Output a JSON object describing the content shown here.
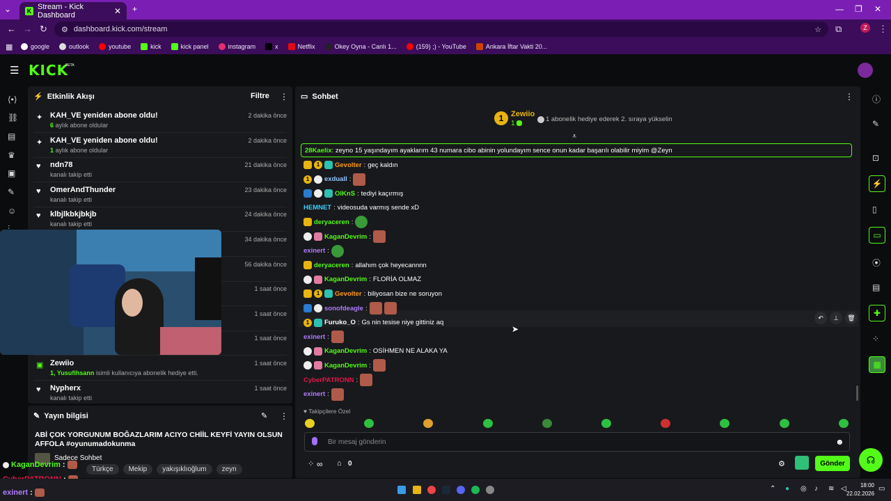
{
  "browser": {
    "tab_title": "Stream - Kick Dashboard",
    "url": "dashboard.kick.com/stream",
    "profile_initial": "Z",
    "bookmarks": [
      "google",
      "outlook",
      "youtube",
      "kick",
      "kick panel",
      "instagram",
      "x",
      "Netflix",
      "Okey Oyna - Canlı 1...",
      "(159) ;) - YouTube",
      "Ankara İftar Vakti 20..."
    ]
  },
  "app": {
    "logo": "KICK",
    "logo_beta": "BETA"
  },
  "activity": {
    "title": "Etkinlik Akışı",
    "filter_label": "Filtre",
    "items": [
      {
        "name": "KAH_VE yeniden abone oldu!",
        "highlight": "6",
        "sub": " aylık abone oldular",
        "time": "2 dakika önce",
        "icon": "sparkle"
      },
      {
        "name": "KAH_VE yeniden abone oldu!",
        "highlight": "1",
        "sub": " aylık abone oldular",
        "time": "2 dakika önce",
        "icon": "sparkle"
      },
      {
        "name": "ndn78",
        "highlight": "",
        "sub": "kanalı takip etti",
        "time": "21 dakika önce",
        "icon": "heart"
      },
      {
        "name": "OmerAndThunder",
        "highlight": "",
        "sub": "kanalı takip etti",
        "time": "23 dakika önce",
        "icon": "heart"
      },
      {
        "name": "klbjlkbkjbkjb",
        "highlight": "",
        "sub": "kanalı takip etti",
        "time": "24 dakika önce",
        "icon": "heart"
      },
      {
        "name": "",
        "highlight": "",
        "sub": "",
        "time": "34 dakika önce",
        "icon": ""
      },
      {
        "name": "",
        "highlight": "",
        "sub": "",
        "time": "56 dakika önce",
        "icon": ""
      },
      {
        "name": "",
        "highlight": "",
        "sub": "",
        "time": "1 saat önce",
        "icon": ""
      },
      {
        "name": "",
        "highlight": "",
        "sub": "",
        "time": "1 saat önce",
        "icon": ""
      },
      {
        "name": "",
        "highlight": "",
        "sub": "",
        "time": "1 saat önce",
        "icon": ""
      },
      {
        "name": "Zewiio",
        "highlight": "1, Yusufihsann",
        "sub": " isimli kullanıcıya abonelik hediye etti.",
        "time": "1 saat önce",
        "icon": "gift"
      },
      {
        "name": "Nypherx",
        "highlight": "",
        "sub": "kanalı takip etti",
        "time": "1 saat önce",
        "icon": "heart"
      }
    ]
  },
  "stream_info": {
    "title": "Yayın bilgisi",
    "stream_title": "ABİ ÇOK YORGUNUM BOĞAZLARIM ACIYO CHİİL KEYFİ YAYIN OLSUN AFFOLA #oyunumadokunma",
    "category": "Sadece Sohbet",
    "tags": [
      "Türkçe",
      "Mekip",
      "yakışıklıoğlum",
      "zeyn"
    ]
  },
  "overlay_chat": [
    {
      "user": "KaganDevrim",
      "color": "#53fc18"
    },
    {
      "user": "CyberPATRONN",
      "color": "#e0174a"
    },
    {
      "user": "exinert",
      "color": "#b07cff"
    }
  ],
  "chat": {
    "title": "Sohbet",
    "top_gifter": {
      "name": "Zewiio",
      "count": "1",
      "promo": "1 abonelik hediye ederek 2. sıraya yükselin"
    },
    "pinned": {
      "user": "28Kaelix",
      "text": "zeyno 15 yaşındayım ayaklarım 43 numara cibo abinin yolundayım sence onun kadar başarılı olabilir miyim @Zeyn"
    },
    "messages": [
      {
        "badges": [
          "crown",
          "one",
          "gift"
        ],
        "user": "Gevolter",
        "color": "#ff9a1a",
        "text": "geç kaldın",
        "emotes": 0
      },
      {
        "badges": [
          "one",
          "cat"
        ],
        "user": "exduall",
        "color": "#8ec5ff",
        "text": "",
        "emotes": 1
      },
      {
        "badges": [
          "blue",
          "cat",
          "gift"
        ],
        "user": "OlKnS",
        "color": "#53fc18",
        "text": "tediyi kaçırmış",
        "emotes": 0
      },
      {
        "badges": [],
        "user": "HEMNET",
        "color": "#3ad0ff",
        "text": "videosuda varmış sende xD",
        "emotes": 0
      },
      {
        "badges": [
          "crown"
        ],
        "user": "deryaceren",
        "color": "#53fc18",
        "text": "",
        "emotes": 1
      },
      {
        "badges": [
          "cat",
          "pink"
        ],
        "user": "KaganDevrim",
        "color": "#53fc18",
        "text": "",
        "emotes": 1
      },
      {
        "badges": [],
        "user": "exinert",
        "color": "#b07cff",
        "text": "",
        "emotes": 1
      },
      {
        "badges": [
          "crown"
        ],
        "user": "deryaceren",
        "color": "#53fc18",
        "text": "allahım çok heyecannnn",
        "emotes": 0
      },
      {
        "badges": [
          "cat",
          "pink"
        ],
        "user": "KaganDevrim",
        "color": "#53fc18",
        "text": "FLORİA OLMAZ",
        "emotes": 0
      },
      {
        "badges": [
          "crown",
          "one",
          "gift"
        ],
        "user": "Gevolter",
        "color": "#ff9a1a",
        "text": "biliyosan bize ne soruyon",
        "emotes": 0
      },
      {
        "badges": [
          "blue",
          "cat"
        ],
        "user": "sonofdeagle",
        "color": "#b07cff",
        "text": "",
        "emotes": 2
      },
      {
        "badges": [
          "one",
          "gift"
        ],
        "user": "Furuko_O",
        "color": "#ffffff",
        "text": "Gs nin tesise niye gittiniz aq",
        "emotes": 0
      },
      {
        "badges": [],
        "user": "exinert",
        "color": "#b07cff",
        "text": "",
        "emotes": 1
      },
      {
        "badges": [
          "cat",
          "pink"
        ],
        "user": "KaganDevrim",
        "color": "#53fc18",
        "text": "OSİHMEN NE ALAKA YA",
        "emotes": 0
      },
      {
        "badges": [
          "cat",
          "pink"
        ],
        "user": "KaganDevrim",
        "color": "#53fc18",
        "text": "",
        "emotes": 1
      },
      {
        "badges": [],
        "user": "CyberPATRONN",
        "color": "#e0174a",
        "text": "",
        "emotes": 1
      },
      {
        "badges": [],
        "user": "exinert",
        "color": "#b07cff",
        "text": "",
        "emotes": 1
      }
    ],
    "followers_only": "Takipçilere Özel",
    "input_placeholder": "Bir mesaj gönderin",
    "send_label": "Gönder",
    "viewer_count": "0",
    "infinity": "∞"
  },
  "taskbar": {
    "time": "18:00",
    "date": "22.02.2026"
  },
  "colors": {
    "accent": "#53fc18",
    "panel": "#18191c",
    "bg": "#0b0c0e",
    "chrome": "#7b1fb4"
  }
}
